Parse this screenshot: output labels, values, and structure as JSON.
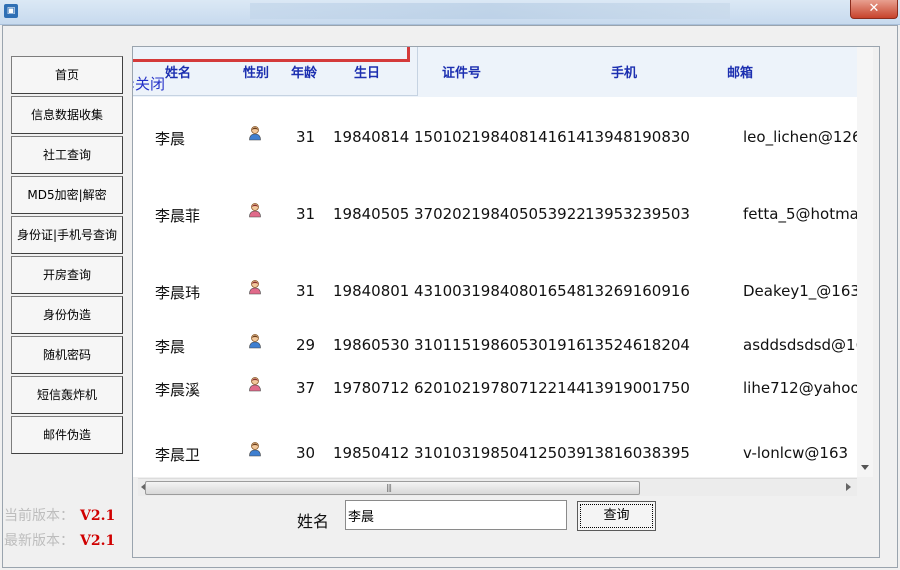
{
  "window": {
    "close_glyph": "✕"
  },
  "nav": [
    {
      "label": "首页"
    },
    {
      "label": "信息数据收集"
    },
    {
      "label": "社工查询"
    },
    {
      "label": "MD5加密|解密"
    },
    {
      "label": "身份证|手机号查询"
    },
    {
      "label": "开房查询"
    },
    {
      "label": "身份伪造"
    },
    {
      "label": "随机密码"
    },
    {
      "label": "短信轰炸机"
    },
    {
      "label": "邮件伪造"
    }
  ],
  "version": {
    "current_label": "当前版本：",
    "current_value": "V2.1",
    "latest_label": "最新版本：",
    "latest_value": "V2.1"
  },
  "table": {
    "close_label": "‹关闭",
    "columns": [
      "姓名",
      "性别",
      "年龄",
      "生日",
      "证件号",
      "手机",
      "邮箱"
    ],
    "rows": [
      {
        "name": "李晨",
        "gender": "male",
        "age": "31",
        "birthday": "19840814",
        "id": "150102198408141614",
        "phone": "13948190830",
        "email": "leo_lichen@126"
      },
      {
        "name": "李晨菲",
        "gender": "female",
        "age": "31",
        "birthday": "19840505",
        "id": "370202198405053922",
        "phone": "13953239503",
        "email": "fetta_5@hotma"
      },
      {
        "name": "李晨玮",
        "gender": "female",
        "age": "31",
        "birthday": "19840801",
        "id": "431003198408016548",
        "phone": "13269160916",
        "email": "Deakey1_@163"
      },
      {
        "name": "李晨",
        "gender": "male",
        "age": "29",
        "birthday": "19860530",
        "id": "310115198605301916",
        "phone": "13524618204",
        "email": "asddsdsdsd@16"
      },
      {
        "name": "李晨溪",
        "gender": "female",
        "age": "37",
        "birthday": "19780712",
        "id": "620102197807122144",
        "phone": "13919001750",
        "email": "lihe712@yahoo.c"
      },
      {
        "name": "李晨卫",
        "gender": "male",
        "age": "30",
        "birthday": "19850412",
        "id": "310103198504125039",
        "phone": "13816038395",
        "email": "v-lonlcw@163"
      }
    ]
  },
  "search": {
    "label": "姓名",
    "value": "李晨",
    "button_label": "查询"
  },
  "colors": {
    "header_text": "#1c2fb0",
    "version_value": "#d00000",
    "male_icon": "#3f7fd0",
    "female_icon": "#e06a8a"
  }
}
